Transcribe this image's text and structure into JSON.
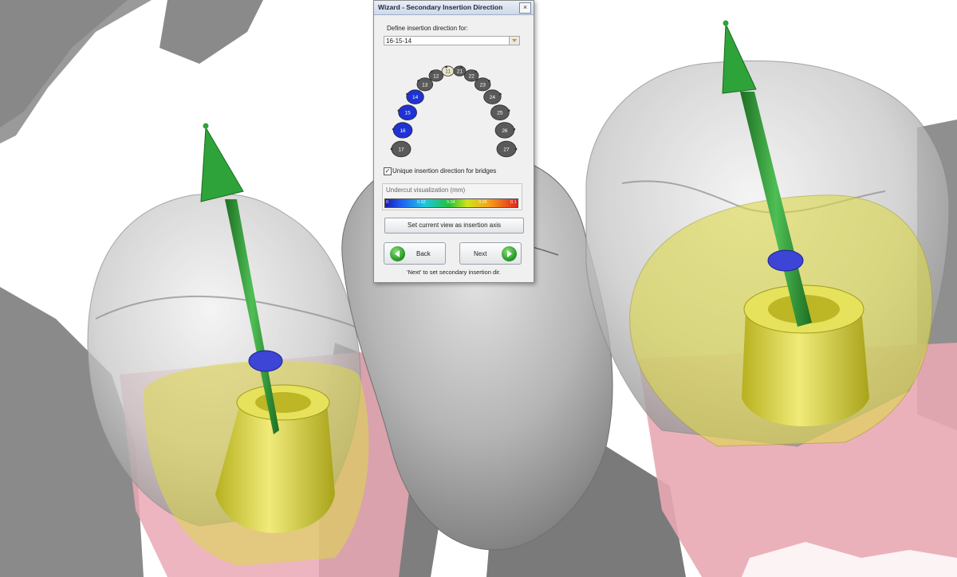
{
  "window": {
    "title": "Wizard - Secondary Insertion Direction",
    "close_glyph": "×"
  },
  "wizard": {
    "define_label": "Define insertion direction for:",
    "combo_value": "16-15-14",
    "teeth_labels": [
      "17",
      "16",
      "15",
      "14",
      "13",
      "12",
      "11",
      "21",
      "22",
      "23",
      "24",
      "25",
      "26",
      "27"
    ],
    "unique_checkbox_label": "Unique insertion direction for bridges",
    "unique_checked": true,
    "undercut_label": "Undercut visualization (mm)",
    "undercut_ticks": [
      "0",
      "0.02",
      "0.04",
      "0.06",
      "0.1"
    ],
    "set_view_button": "Set current view as insertion axis",
    "back_button": "Back",
    "next_button": "Next",
    "footer_hint": "'Next' to set secondary insertion dir."
  },
  "colors": {
    "arrow_green": "#2ea33a",
    "gingiva_pink": "#e9a8b4",
    "abutment_yellow": "#ddd84a",
    "tooth_gray": "#bdbdbd",
    "selected_tooth_blue": "#1e32d6"
  }
}
